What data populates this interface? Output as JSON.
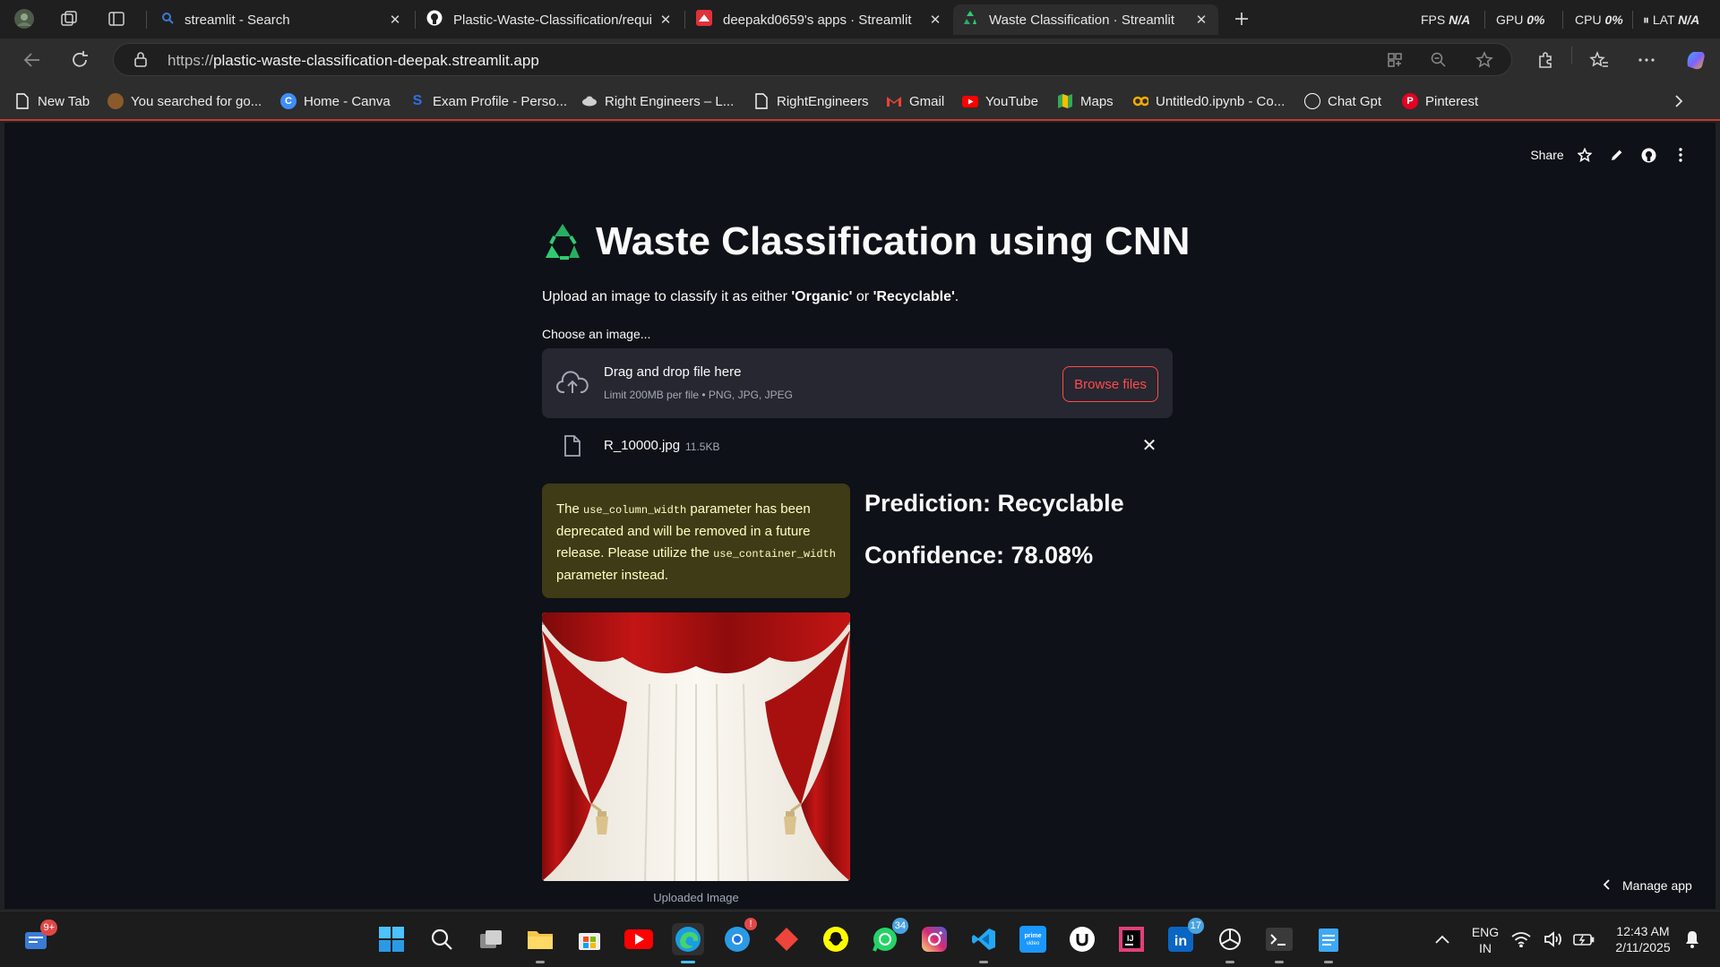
{
  "browser": {
    "tabs": [
      {
        "title": "streamlit - Search",
        "icon": "search-icon"
      },
      {
        "title": "Plastic-Waste-Classification/requi",
        "icon": "github-icon"
      },
      {
        "title": "deepakd0659's apps · Streamlit",
        "icon": "streamlit-icon"
      },
      {
        "title": "Waste Classification · Streamlit",
        "icon": "recycle-icon",
        "active": true
      }
    ],
    "perf": {
      "fps_label": "FPS",
      "fps_value": "N/A",
      "gpu_label": "GPU",
      "gpu_value": "0%",
      "cpu_label": "CPU",
      "cpu_value": "0%",
      "lat_label": "LAT",
      "lat_value": "N/A"
    },
    "address": {
      "scheme": "https://",
      "host": "plastic-waste-classification-deepak.streamlit.app"
    },
    "favorites": [
      {
        "label": "New Tab",
        "icon": "page-icon",
        "color": "#ffffff"
      },
      {
        "label": "You searched for go...",
        "icon": "cookie-icon",
        "color": "#b5651d"
      },
      {
        "label": "Home - Canva",
        "icon": "canva-icon",
        "color": "#3e8ef7"
      },
      {
        "label": "Exam Profile - Perso...",
        "icon": "s-icon",
        "color": "#2f6fe4"
      },
      {
        "label": "Right Engineers – L...",
        "icon": "cloud-icon",
        "color": "#cfcfcf"
      },
      {
        "label": "RightEngineers",
        "icon": "page-icon",
        "color": "#ffffff"
      },
      {
        "label": "Gmail",
        "icon": "gmail-icon",
        "color": "#ea4335"
      },
      {
        "label": "YouTube",
        "icon": "youtube-icon",
        "color": "#ff0000"
      },
      {
        "label": "Maps",
        "icon": "maps-icon",
        "color": "#34a853"
      },
      {
        "label": "Untitled0.ipynb - Co...",
        "icon": "colab-icon",
        "color": "#f9ab00"
      },
      {
        "label": "Chat Gpt",
        "icon": "chatgpt-icon",
        "color": "#ffffff"
      },
      {
        "label": "Pinterest",
        "icon": "pinterest-icon",
        "color": "#e60023"
      }
    ]
  },
  "app": {
    "header": {
      "share_label": "Share"
    },
    "title_emoji": "♻️",
    "title": "Waste Classification using CNN",
    "subtitle": {
      "prefix": "Upload an image to classify it as either ",
      "opt1": "'Organic'",
      "mid": " or ",
      "opt2": "'Recyclable'",
      "suffix": "."
    },
    "uploader": {
      "label": "Choose an image...",
      "drag_text": "Drag and drop file here",
      "limit_text": "Limit 200MB per file • PNG, JPG, JPEG",
      "browse_label": "Browse files"
    },
    "file": {
      "name": "R_10000.jpg",
      "size": "11.5KB"
    },
    "warning": {
      "t1": "The ",
      "code1": "use_column_width",
      "t2": " parameter has been deprecated and will be removed in a future release. Please utilize the ",
      "code2": "use_container_width",
      "t3": " parameter instead."
    },
    "prediction": "Prediction: Recyclable",
    "confidence": "Confidence: 78.08%",
    "image_caption": "Uploaded Image",
    "manage_app": "Manage app"
  },
  "taskbar": {
    "widgets_badge": "9+",
    "whatsapp_badge": "34",
    "linkedin_badge": "17",
    "lang_line1": "ENG",
    "lang_line2": "IN",
    "time": "12:43 AM",
    "date": "2/11/2025"
  },
  "colors": {
    "app_bg": "#0e1117",
    "accent": "#ff4b4b",
    "warning_bg": "#3e3b16",
    "warning_text": "#ffffc2"
  }
}
